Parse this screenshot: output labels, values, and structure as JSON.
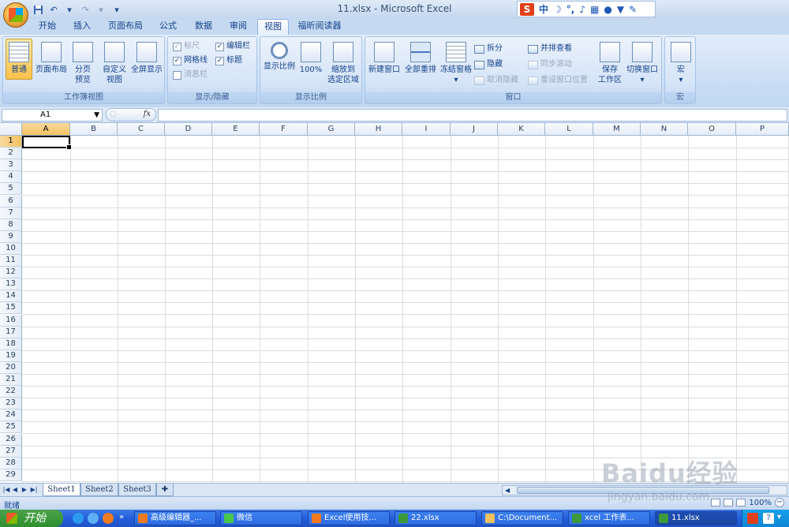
{
  "window": {
    "title": "11.xlsx - Microsoft Excel"
  },
  "qat": {
    "save_icon": "save-icon",
    "undo_icon": "undo-icon",
    "redo_icon": "redo-icon",
    "customize_icon": "dropdown-icon"
  },
  "ime": {
    "label": "中"
  },
  "tabs": [
    {
      "label": "开始"
    },
    {
      "label": "插入"
    },
    {
      "label": "页面布局"
    },
    {
      "label": "公式"
    },
    {
      "label": "数据"
    },
    {
      "label": "审阅"
    },
    {
      "label": "视图"
    },
    {
      "label": "福昕阅读器"
    }
  ],
  "active_tab": "视图",
  "ribbon": {
    "workbook_views": {
      "label": "工作簿视图",
      "normal": "普通",
      "page_layout": "页面布局",
      "page_break_1": "分页",
      "page_break_2": "预览",
      "custom_1": "自定义",
      "custom_2": "视图",
      "full_screen": "全屏显示"
    },
    "show_hide": {
      "label": "显示/隐藏",
      "ruler": "标尺",
      "gridlines": "网格线",
      "message_bar": "消息栏",
      "formula_bar": "编辑栏",
      "headings": "标题",
      "checked_mark": "✓"
    },
    "zoom": {
      "label": "显示比例",
      "zoom": "显示比例",
      "hundred": "100%",
      "zoom_sel_1": "缩放到",
      "zoom_sel_2": "选定区域"
    },
    "window": {
      "label": "窗口",
      "new_window": "新建窗口",
      "arrange_all": "全部重排",
      "freeze_panes": "冻结窗格",
      "split": "拆分",
      "hide": "隐藏",
      "unhide": "取消隐藏",
      "side_by_side": "并排查看",
      "sync_scroll": "同步滚动",
      "reset_position": "重设窗口位置",
      "save_workspace_1": "保存",
      "save_workspace_2": "工作区",
      "switch_windows": "切换窗口"
    },
    "macros": {
      "label": "宏",
      "macros": "宏"
    }
  },
  "formula_bar": {
    "name_box": "A1",
    "fx_label": "fx",
    "formula": ""
  },
  "columns": [
    "A",
    "B",
    "C",
    "D",
    "E",
    "F",
    "G",
    "H",
    "I",
    "J",
    "K",
    "L",
    "M",
    "N",
    "O",
    "P"
  ],
  "rows": [
    "1",
    "2",
    "3",
    "4",
    "5",
    "6",
    "7",
    "8",
    "9",
    "10",
    "11",
    "12",
    "13",
    "14",
    "15",
    "16",
    "17",
    "18",
    "19",
    "20",
    "21",
    "22",
    "23",
    "24",
    "25",
    "26",
    "27",
    "28",
    "29"
  ],
  "active_cell": "A1",
  "sheets": [
    {
      "label": "Sheet1",
      "active": true
    },
    {
      "label": "Sheet2",
      "active": false
    },
    {
      "label": "Sheet3",
      "active": false
    }
  ],
  "status": {
    "text": "就绪",
    "zoom_text": "100%"
  },
  "taskbar": {
    "start": "开始",
    "items": [
      {
        "label": "高级编辑器_..."
      },
      {
        "label": "微信"
      },
      {
        "label": "Excel使用技..."
      },
      {
        "label": "22.xlsx"
      },
      {
        "label": "C:\\Document..."
      },
      {
        "label": "xcel 工作表..."
      },
      {
        "label": "11.xlsx"
      }
    ]
  },
  "watermark": {
    "brand": "Baidu经验",
    "url": "jingyan.baidu.com"
  },
  "colors": {
    "ribbon_bg": "#c9ddf5",
    "selected_header": "#f1c15f",
    "taskbar": "#245edb"
  }
}
